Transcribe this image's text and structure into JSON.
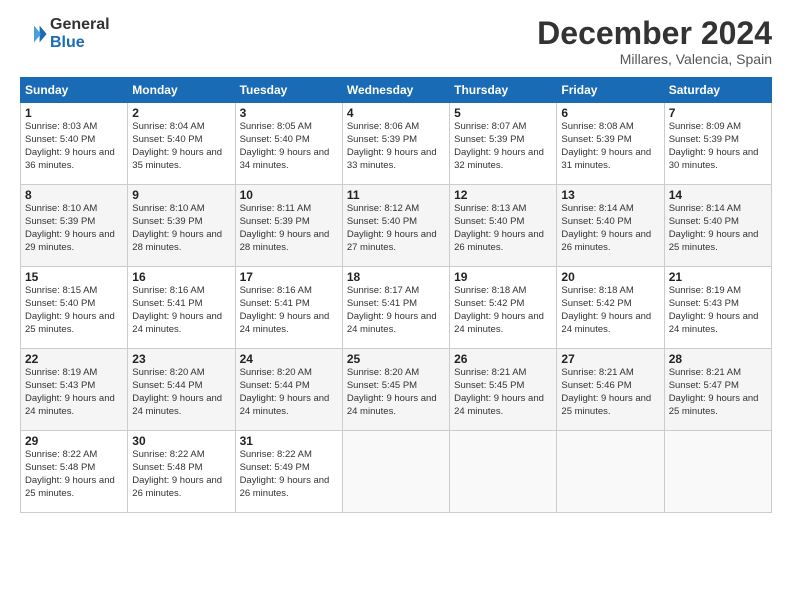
{
  "logo": {
    "general": "General",
    "blue": "Blue"
  },
  "title": {
    "month": "December 2024",
    "location": "Millares, Valencia, Spain"
  },
  "weekdays": [
    "Sunday",
    "Monday",
    "Tuesday",
    "Wednesday",
    "Thursday",
    "Friday",
    "Saturday"
  ],
  "weeks": [
    [
      {
        "day": "1",
        "sunrise": "8:03 AM",
        "sunset": "5:40 PM",
        "daylight": "9 hours and 36 minutes."
      },
      {
        "day": "2",
        "sunrise": "8:04 AM",
        "sunset": "5:40 PM",
        "daylight": "9 hours and 35 minutes."
      },
      {
        "day": "3",
        "sunrise": "8:05 AM",
        "sunset": "5:40 PM",
        "daylight": "9 hours and 34 minutes."
      },
      {
        "day": "4",
        "sunrise": "8:06 AM",
        "sunset": "5:39 PM",
        "daylight": "9 hours and 33 minutes."
      },
      {
        "day": "5",
        "sunrise": "8:07 AM",
        "sunset": "5:39 PM",
        "daylight": "9 hours and 32 minutes."
      },
      {
        "day": "6",
        "sunrise": "8:08 AM",
        "sunset": "5:39 PM",
        "daylight": "9 hours and 31 minutes."
      },
      {
        "day": "7",
        "sunrise": "8:09 AM",
        "sunset": "5:39 PM",
        "daylight": "9 hours and 30 minutes."
      }
    ],
    [
      {
        "day": "8",
        "sunrise": "8:10 AM",
        "sunset": "5:39 PM",
        "daylight": "9 hours and 29 minutes."
      },
      {
        "day": "9",
        "sunrise": "8:10 AM",
        "sunset": "5:39 PM",
        "daylight": "9 hours and 28 minutes."
      },
      {
        "day": "10",
        "sunrise": "8:11 AM",
        "sunset": "5:39 PM",
        "daylight": "9 hours and 28 minutes."
      },
      {
        "day": "11",
        "sunrise": "8:12 AM",
        "sunset": "5:40 PM",
        "daylight": "9 hours and 27 minutes."
      },
      {
        "day": "12",
        "sunrise": "8:13 AM",
        "sunset": "5:40 PM",
        "daylight": "9 hours and 26 minutes."
      },
      {
        "day": "13",
        "sunrise": "8:14 AM",
        "sunset": "5:40 PM",
        "daylight": "9 hours and 26 minutes."
      },
      {
        "day": "14",
        "sunrise": "8:14 AM",
        "sunset": "5:40 PM",
        "daylight": "9 hours and 25 minutes."
      }
    ],
    [
      {
        "day": "15",
        "sunrise": "8:15 AM",
        "sunset": "5:40 PM",
        "daylight": "9 hours and 25 minutes."
      },
      {
        "day": "16",
        "sunrise": "8:16 AM",
        "sunset": "5:41 PM",
        "daylight": "9 hours and 24 minutes."
      },
      {
        "day": "17",
        "sunrise": "8:16 AM",
        "sunset": "5:41 PM",
        "daylight": "9 hours and 24 minutes."
      },
      {
        "day": "18",
        "sunrise": "8:17 AM",
        "sunset": "5:41 PM",
        "daylight": "9 hours and 24 minutes."
      },
      {
        "day": "19",
        "sunrise": "8:18 AM",
        "sunset": "5:42 PM",
        "daylight": "9 hours and 24 minutes."
      },
      {
        "day": "20",
        "sunrise": "8:18 AM",
        "sunset": "5:42 PM",
        "daylight": "9 hours and 24 minutes."
      },
      {
        "day": "21",
        "sunrise": "8:19 AM",
        "sunset": "5:43 PM",
        "daylight": "9 hours and 24 minutes."
      }
    ],
    [
      {
        "day": "22",
        "sunrise": "8:19 AM",
        "sunset": "5:43 PM",
        "daylight": "9 hours and 24 minutes."
      },
      {
        "day": "23",
        "sunrise": "8:20 AM",
        "sunset": "5:44 PM",
        "daylight": "9 hours and 24 minutes."
      },
      {
        "day": "24",
        "sunrise": "8:20 AM",
        "sunset": "5:44 PM",
        "daylight": "9 hours and 24 minutes."
      },
      {
        "day": "25",
        "sunrise": "8:20 AM",
        "sunset": "5:45 PM",
        "daylight": "9 hours and 24 minutes."
      },
      {
        "day": "26",
        "sunrise": "8:21 AM",
        "sunset": "5:45 PM",
        "daylight": "9 hours and 24 minutes."
      },
      {
        "day": "27",
        "sunrise": "8:21 AM",
        "sunset": "5:46 PM",
        "daylight": "9 hours and 25 minutes."
      },
      {
        "day": "28",
        "sunrise": "8:21 AM",
        "sunset": "5:47 PM",
        "daylight": "9 hours and 25 minutes."
      }
    ],
    [
      {
        "day": "29",
        "sunrise": "8:22 AM",
        "sunset": "5:48 PM",
        "daylight": "9 hours and 25 minutes."
      },
      {
        "day": "30",
        "sunrise": "8:22 AM",
        "sunset": "5:48 PM",
        "daylight": "9 hours and 26 minutes."
      },
      {
        "day": "31",
        "sunrise": "8:22 AM",
        "sunset": "5:49 PM",
        "daylight": "9 hours and 26 minutes."
      },
      null,
      null,
      null,
      null
    ]
  ]
}
